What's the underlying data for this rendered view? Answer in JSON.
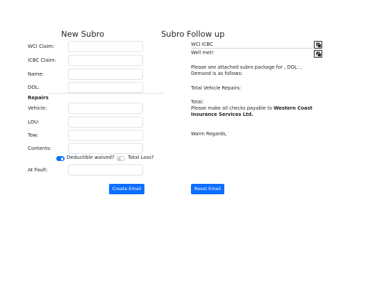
{
  "left": {
    "title": "New Subro",
    "fields": [
      {
        "label": "WCI Claim:",
        "value": ""
      },
      {
        "label": "ICBC Claim:",
        "value": ""
      },
      {
        "label": "Name:",
        "value": ""
      },
      {
        "label": "DOL:",
        "value": ""
      }
    ],
    "repairs_title": "Repairs",
    "repair_fields": [
      {
        "label": "Vehicle:",
        "value": ""
      },
      {
        "label": "LOU:",
        "value": ""
      },
      {
        "label": "Tow:",
        "value": ""
      },
      {
        "label": "Contents:",
        "value": ""
      }
    ],
    "deductible_waived": {
      "label": "Deductible waived?",
      "checked": true
    },
    "total_loss": {
      "label": "Total Loss?",
      "checked": false
    },
    "at_fault": {
      "label": "At Fault:",
      "value": ""
    },
    "create_button": "Create Email"
  },
  "right": {
    "title": "Subro Follow up",
    "subject": "WCI ICBC",
    "greeting": "Well met!",
    "line1": "Please see attached subro package for , DOL: ,",
    "line2": "Demand is as follows:",
    "total_vehicle": "Total Vehicle Repairs:",
    "total": "Total:",
    "cheque_line_prefix": "Please make all checks payable to",
    "company_line1": "Western Coast",
    "company_line2": "Insurance Services Ltd.",
    "period": ".",
    "closing": "Warm Regards,",
    "reset_button": "Reset Email"
  },
  "colors": {
    "accent": "#0d6efd",
    "border": "#dee2e6"
  },
  "icons": [
    "copy-icon",
    "copy-icon"
  ]
}
